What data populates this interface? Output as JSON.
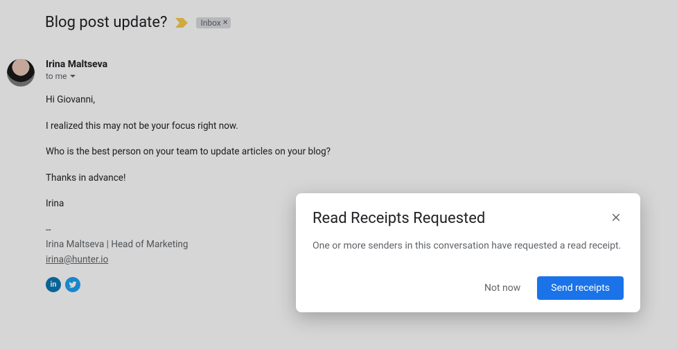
{
  "email": {
    "subject": "Blog post update?",
    "label": "Inbox",
    "sender_name": "Irina Maltseva",
    "recipient_line": "to me",
    "body": {
      "p1": "Hi Giovanni,",
      "p2": "I realized this may not be your focus right now.",
      "p3": "Who is the best person on your team to update articles on your blog?",
      "p4": "Thanks in advance!",
      "p5": "Irina"
    },
    "signature": {
      "sep": "--",
      "line": "Irina Maltseva | Head of Marketing",
      "email": "irina@hunter.io"
    }
  },
  "dialog": {
    "title": "Read Receipts Requested",
    "body": "One or more senders in this conversation have requested a read receipt.",
    "not_now": "Not now",
    "send": "Send receipts"
  }
}
